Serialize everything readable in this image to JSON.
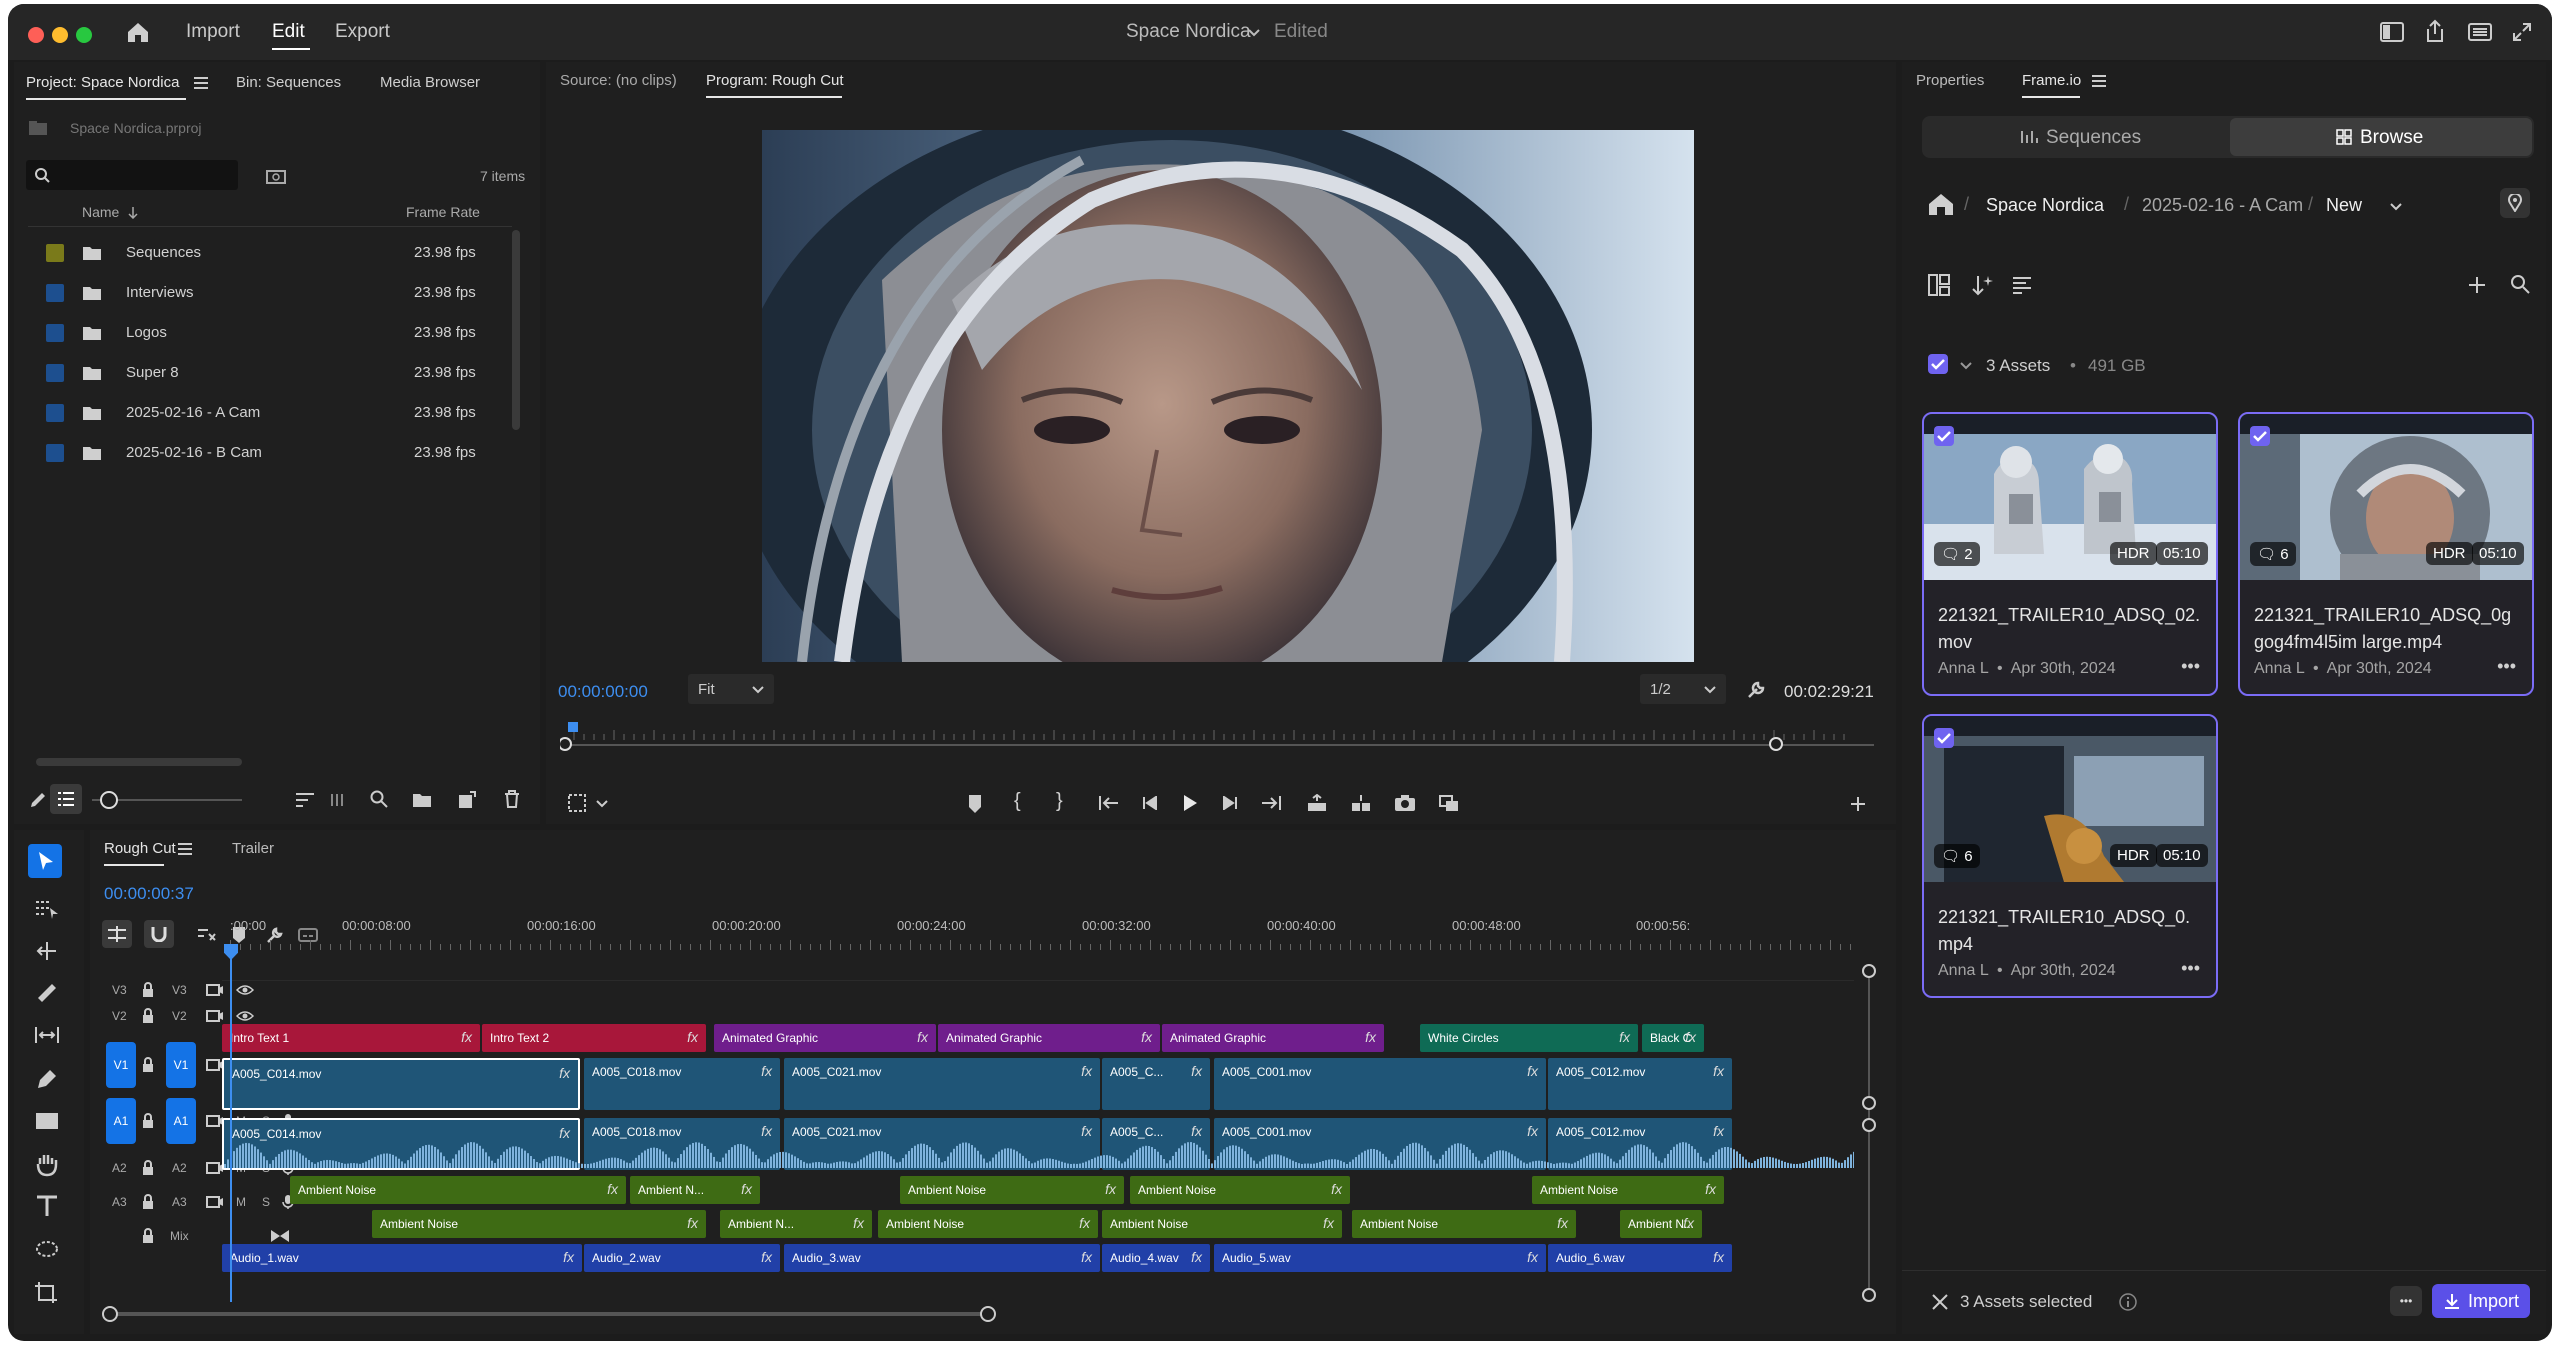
{
  "menu": {
    "import": "Import",
    "edit": "Edit",
    "export": "Export"
  },
  "title": {
    "project": "Space Nordica",
    "status": "Edited"
  },
  "project_panel": {
    "tabs": [
      "Project: Space Nordica",
      "Bin: Sequences",
      "Media Browser"
    ],
    "file": "Space Nordica.prproj",
    "search_placeholder": "",
    "count": "7 items",
    "col_name": "Name",
    "col_rate": "Frame Rate",
    "items": [
      {
        "name": "Sequences",
        "rate": "23.98 fps",
        "color": "#7a7a1a"
      },
      {
        "name": "Interviews",
        "rate": "23.98 fps",
        "color": "#1d4f8f"
      },
      {
        "name": "Logos",
        "rate": "23.98 fps",
        "color": "#1d4f8f"
      },
      {
        "name": "Super 8",
        "rate": "23.98 fps",
        "color": "#1d4f8f"
      },
      {
        "name": "2025-02-16 - A Cam",
        "rate": "23.98 fps",
        "color": "#1d4f8f"
      },
      {
        "name": "2025-02-16 - B Cam",
        "rate": "23.98 fps",
        "color": "#1d4f8f"
      }
    ]
  },
  "monitor": {
    "source_tab": "Source: (no clips)",
    "program_tab": "Program: Rough Cut",
    "timecode": "00:00:00:00",
    "fit": "Fit",
    "quality": "1/2",
    "duration": "00:02:29:21",
    "playhead_fraction": 0.0
  },
  "timeline": {
    "tabs": [
      "Rough Cut",
      "Trailer"
    ],
    "timecode": "00:00:00:37",
    "ruler": [
      ":00:00",
      "00:00:08:00",
      "00:00:16:00",
      "00:00:20:00",
      "00:00:24:00",
      "00:00:32:00",
      "00:00:40:00",
      "00:00:48:00",
      "00:00:56:"
    ],
    "track_labels": {
      "v3": "V3",
      "v2": "V2",
      "v1": "V1",
      "a1": "A1",
      "a2": "A2",
      "a3": "A3",
      "mix": "Mix",
      "m": "M",
      "s": "S"
    },
    "v2_clips": [
      "Intro Text 1",
      "Intro Text 2",
      "Animated Graphic",
      "Animated Graphic",
      "Animated Graphic",
      "White Circles",
      "Black C"
    ],
    "v1_clips": [
      "A005_C014.mov",
      "A005_C018.mov",
      "A005_C021.mov",
      "A005_C...",
      "A005_C001.mov",
      "A005_C012.mov"
    ],
    "a1_clips": [
      "A005_C014.mov",
      "A005_C018.mov",
      "A005_C021.mov",
      "A005_C...",
      "A005_C001.mov",
      "A005_C012.mov"
    ],
    "a2_clips": [
      "Ambient Noise",
      "Ambient N...",
      "Ambient Noise",
      "Ambient Noise",
      "Ambient Noise"
    ],
    "a3_clips": [
      "Ambient Noise",
      "Ambient N...",
      "Ambient Noise",
      "Ambient Noise",
      "Ambient Noise",
      "Ambient N..."
    ],
    "mix_clips": [
      "Audio_1.wav",
      "Audio_2.wav",
      "Audio_3.wav",
      "Audio_4.wav",
      "Audio_5.wav",
      "Audio_6.wav"
    ],
    "fx": "fx"
  },
  "frameio": {
    "tabs": [
      "Properties",
      "Frame.io"
    ],
    "seg_sequences": "Sequences",
    "seg_browse": "Browse",
    "breadcrumb": [
      "Space Nordica",
      "2025-02-16 - A Cam",
      "New"
    ],
    "assets_count": "3 Assets",
    "assets_size": "491 GB",
    "cards": [
      {
        "name": "221321_TRAILER10_ADSQ_02.mov",
        "comments": "2",
        "hdr": "HDR",
        "dur": "05:10",
        "author": "Anna L",
        "date": "Apr 30th, 2024"
      },
      {
        "name": "221321_TRAILER10_ADSQ_0ggog4fm4l5im large.mp4",
        "comments": "6",
        "hdr": "HDR",
        "dur": "05:10",
        "author": "Anna L",
        "date": "Apr 30th, 2024"
      },
      {
        "name": "221321_TRAILER10_ADSQ_0.mp4",
        "comments": "6",
        "hdr": "HDR",
        "dur": "05:10",
        "author": "Anna L",
        "date": "Apr 30th, 2024"
      }
    ],
    "selected": "3 Assets selected",
    "import": "Import",
    "dot": "•",
    "more": "•••"
  },
  "colors": {
    "accent": "#1473e6",
    "frameio": "#6f63f0",
    "v2_red": "#a8173a",
    "v2_purple": "#6f1e8c",
    "v2_teal": "#0f6b55",
    "video": "#1f5577",
    "audio": "#1f5577",
    "ambient": "#3e6b14",
    "mix": "#2140a8"
  }
}
